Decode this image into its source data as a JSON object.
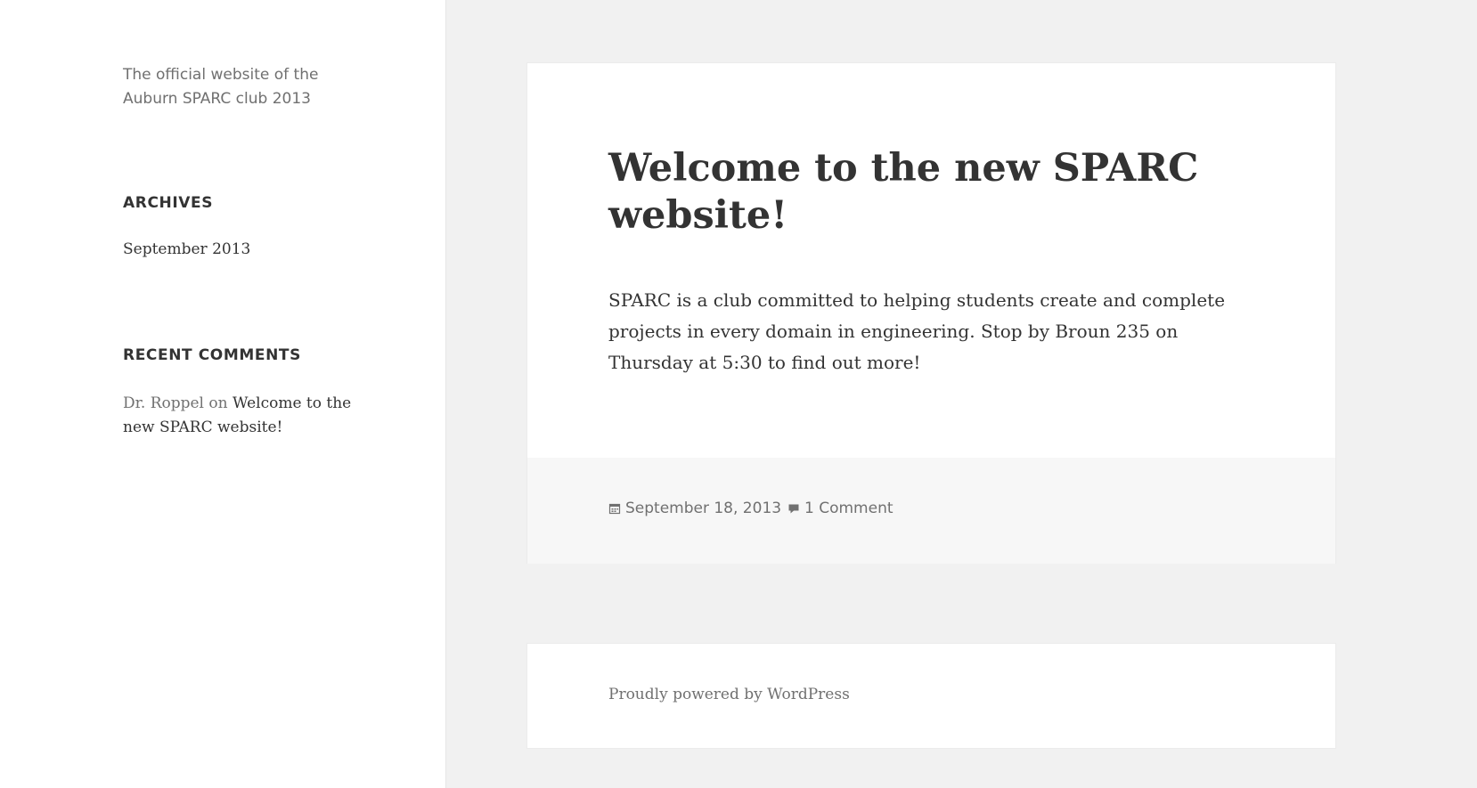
{
  "sidebar": {
    "site_description": "The official website of the Auburn SPARC club 2013",
    "archives": {
      "title": "Archives",
      "items": [
        {
          "label": "September 2013"
        }
      ]
    },
    "recent_comments": {
      "title": "Recent Comments",
      "items": [
        {
          "author": "Dr. Roppel",
          "connector": "on",
          "post": "Welcome to the new SPARC website!"
        }
      ]
    }
  },
  "post": {
    "title": "Welcome to the new SPARC website!",
    "body": "SPARC is a club committed to helping students create and complete projects in every domain in engineering. Stop by Broun 235 on Thursday at 5:30 to find out more!",
    "date": "September 18, 2013",
    "comments": "1 Comment",
    "date_icon": "calendar-icon",
    "comments_icon": "comment-bubble-icon"
  },
  "footer": {
    "powered_by": "Proudly powered by WordPress"
  },
  "colors": {
    "page_bg": "#f1f1f1",
    "card_bg": "#ffffff",
    "footer_meta_bg": "#f7f7f7",
    "text": "#333333",
    "muted_text": "#707070"
  }
}
